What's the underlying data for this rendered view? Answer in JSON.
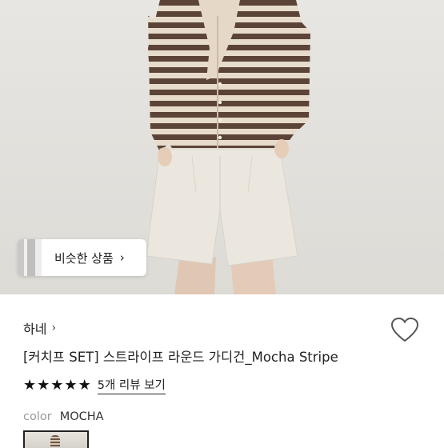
{
  "similar_products": {
    "label": "비슷한 상품",
    "chevron": "›",
    "thumb": "similar-thumbnail"
  },
  "seller": {
    "name": "하네",
    "chevron": "›"
  },
  "product": {
    "title": "[커치프 SET] 스트라이프 라운드 가디건_Mocha Stripe"
  },
  "rating": {
    "stars": 5,
    "star_char": "★",
    "review_link": "5개 리뷰 보기"
  },
  "option": {
    "key": "color",
    "value": "MOCHA"
  },
  "colors": {
    "stripe_dark": "#5b4437",
    "stripe_light": "#e7dccb",
    "shorts": "#ebe7df",
    "background": "#e2e0dc",
    "text": "#222222"
  },
  "icons": {
    "wishlist": "heart-icon"
  }
}
